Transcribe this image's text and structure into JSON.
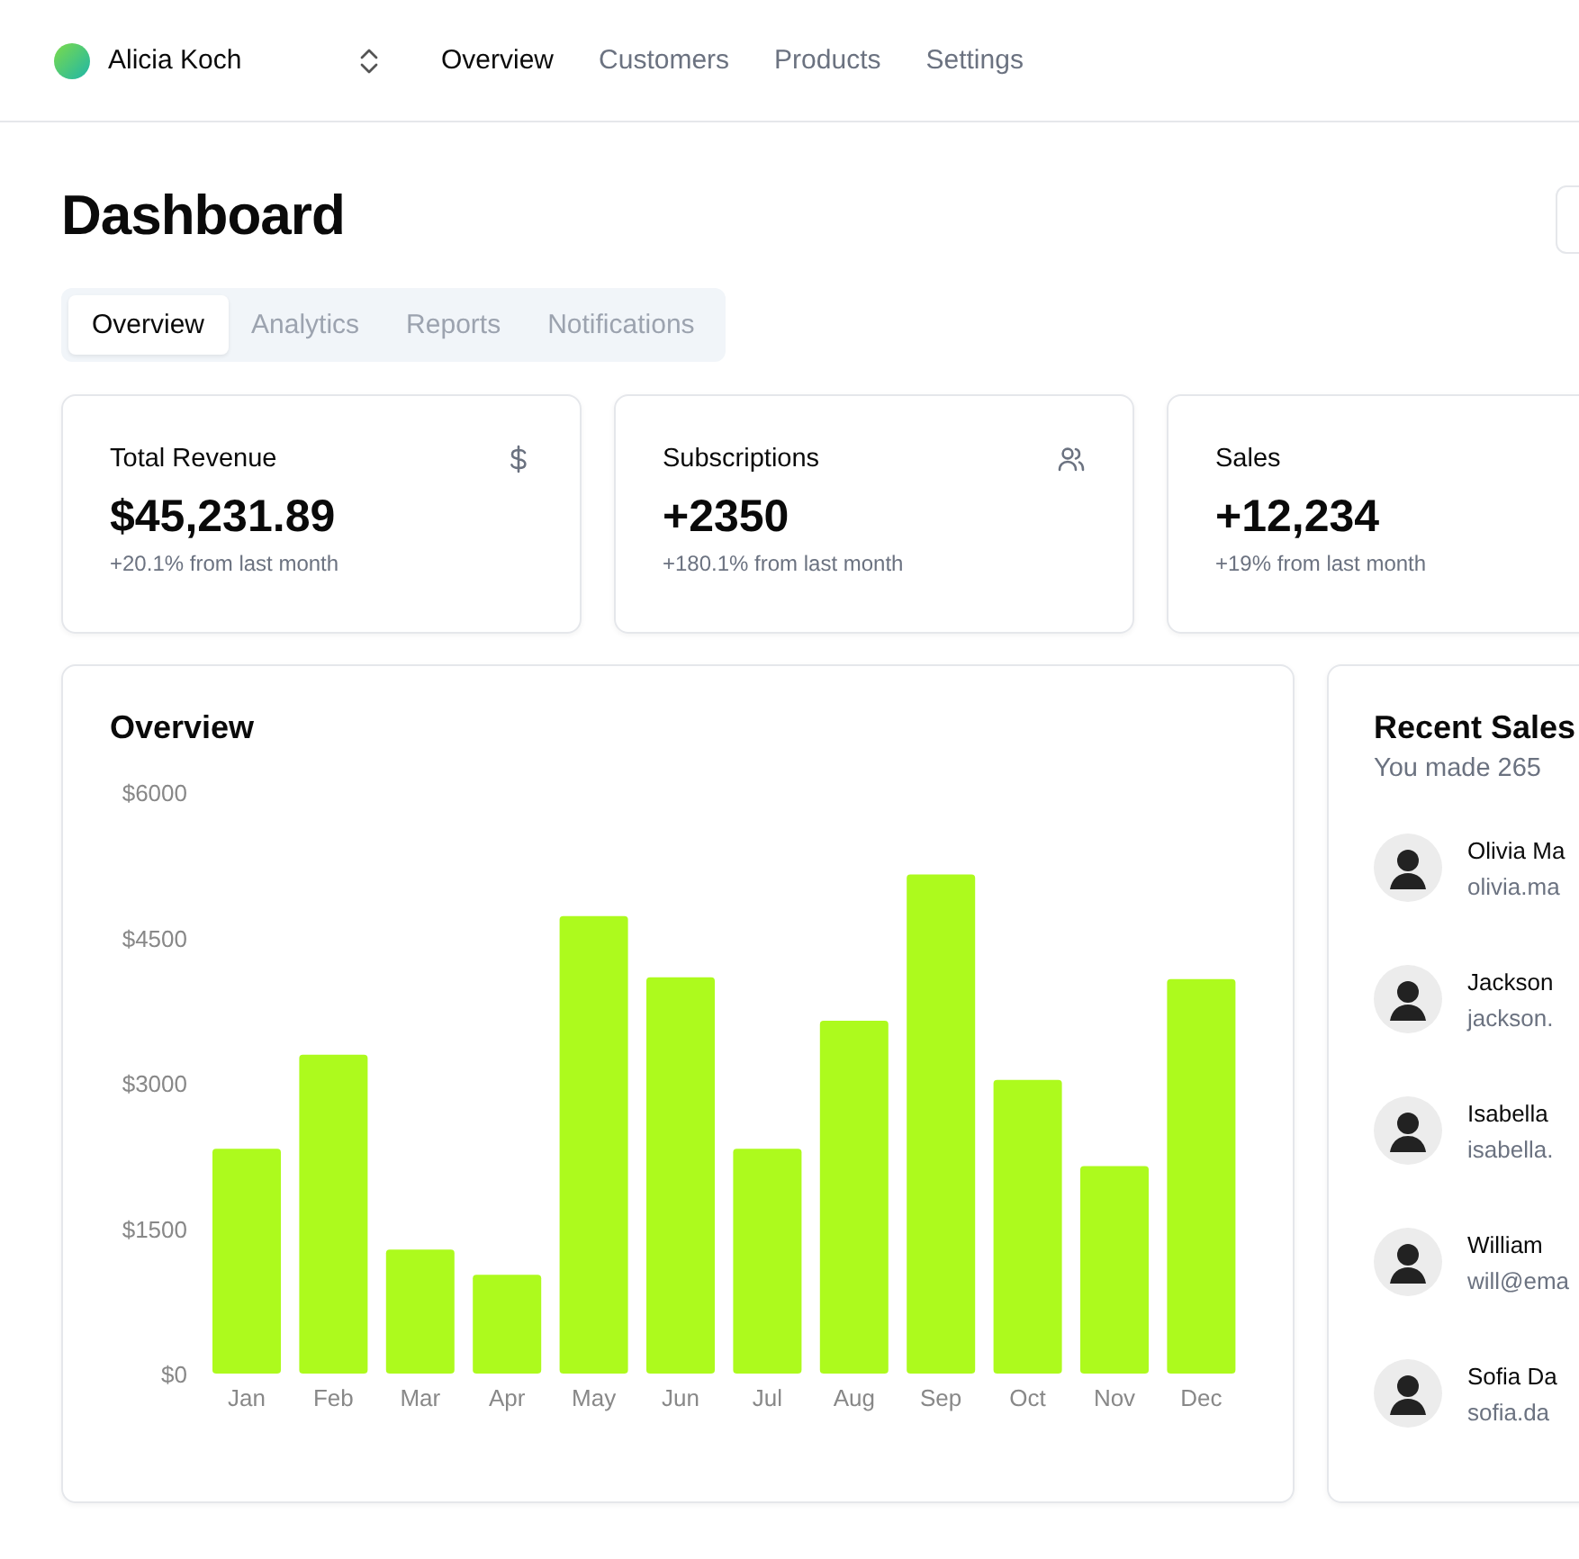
{
  "header": {
    "user": "Alicia Koch",
    "nav": [
      {
        "label": "Overview",
        "selected": true
      },
      {
        "label": "Customers",
        "selected": false
      },
      {
        "label": "Products",
        "selected": false
      },
      {
        "label": "Settings",
        "selected": false
      }
    ]
  },
  "title": "Dashboard",
  "tabs": [
    {
      "label": "Overview",
      "selected": true
    },
    {
      "label": "Analytics",
      "selected": false
    },
    {
      "label": "Reports",
      "selected": false
    },
    {
      "label": "Notifications",
      "selected": false
    }
  ],
  "stats": [
    {
      "title": "Total Revenue",
      "value": "$45,231.89",
      "change": "+20.1% from last month"
    },
    {
      "title": "Subscriptions",
      "value": "+2350",
      "change": "+180.1% from last month"
    },
    {
      "title": "Sales",
      "value": "+12,234",
      "change": "+19% from last month"
    }
  ],
  "overview": {
    "title": "Overview",
    "chart_data": {
      "type": "bar",
      "categories": [
        "Jan",
        "Feb",
        "Mar",
        "Apr",
        "May",
        "Jun",
        "Jul",
        "Aug",
        "Sep",
        "Oct",
        "Nov",
        "Dec"
      ],
      "series": [
        {
          "color": "#adfa1d",
          "values": [
            2320,
            3290,
            1280,
            1020,
            4720,
            4090,
            2320,
            3640,
            5150,
            3030,
            2140,
            4070
          ]
        }
      ],
      "ylim": [
        0,
        6000
      ],
      "yticks": [
        {
          "value": 0,
          "label": "$0"
        },
        {
          "value": 1500,
          "label": "$1500"
        },
        {
          "value": 3000,
          "label": "$3000"
        },
        {
          "value": 4500,
          "label": "$4500"
        },
        {
          "value": 6000,
          "label": "$6000"
        }
      ]
    }
  },
  "recent_sales": {
    "title": "Recent Sales",
    "subtitle": "You made 265",
    "sales": [
      {
        "name": "Olivia Ma",
        "email": "olivia.ma"
      },
      {
        "name": "Jackson",
        "email": "jackson."
      },
      {
        "name": "Isabella",
        "email": "isabella."
      },
      {
        "name": "William",
        "email": "will@ema"
      },
      {
        "name": "Sofia Da",
        "email": "sofia.da"
      }
    ]
  }
}
